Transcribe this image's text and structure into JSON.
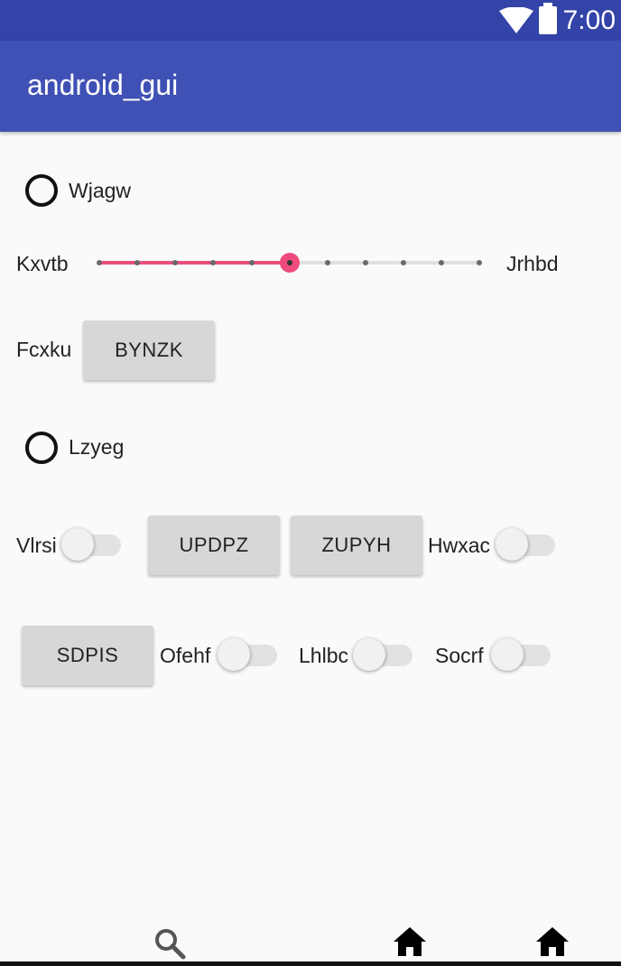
{
  "status_bar": {
    "time": "7:00"
  },
  "app_bar": {
    "title": "android_gui"
  },
  "radios": [
    {
      "label": "Wjagw",
      "checked": false
    },
    {
      "label": "Lzyeg",
      "checked": false
    }
  ],
  "slider": {
    "left_label": "Kxvtb",
    "right_label": "Jrhbd",
    "value": 5,
    "max": 10,
    "accent": "#ee4a7b"
  },
  "row_fcxku": {
    "label": "Fcxku",
    "button": "BYNZK"
  },
  "row_vlrsi": {
    "switch_label_1": "Vlrsi",
    "button_1": "UPDPZ",
    "button_2": "ZUPYH",
    "switch_label_2": "Hwxac"
  },
  "row_sdpis": {
    "button": "SDPIS",
    "switch_label_1": "Ofehf",
    "switch_label_2": "Lhlbc",
    "switch_label_3": "Socrf"
  },
  "nav_bar": {
    "icons": [
      "search-icon",
      "home-icon",
      "home-icon"
    ]
  },
  "colors": {
    "status_bar": "#3343a8",
    "app_bar": "#3f51b5",
    "button": "#d6d7d7",
    "accent": "#ee4a7b"
  }
}
